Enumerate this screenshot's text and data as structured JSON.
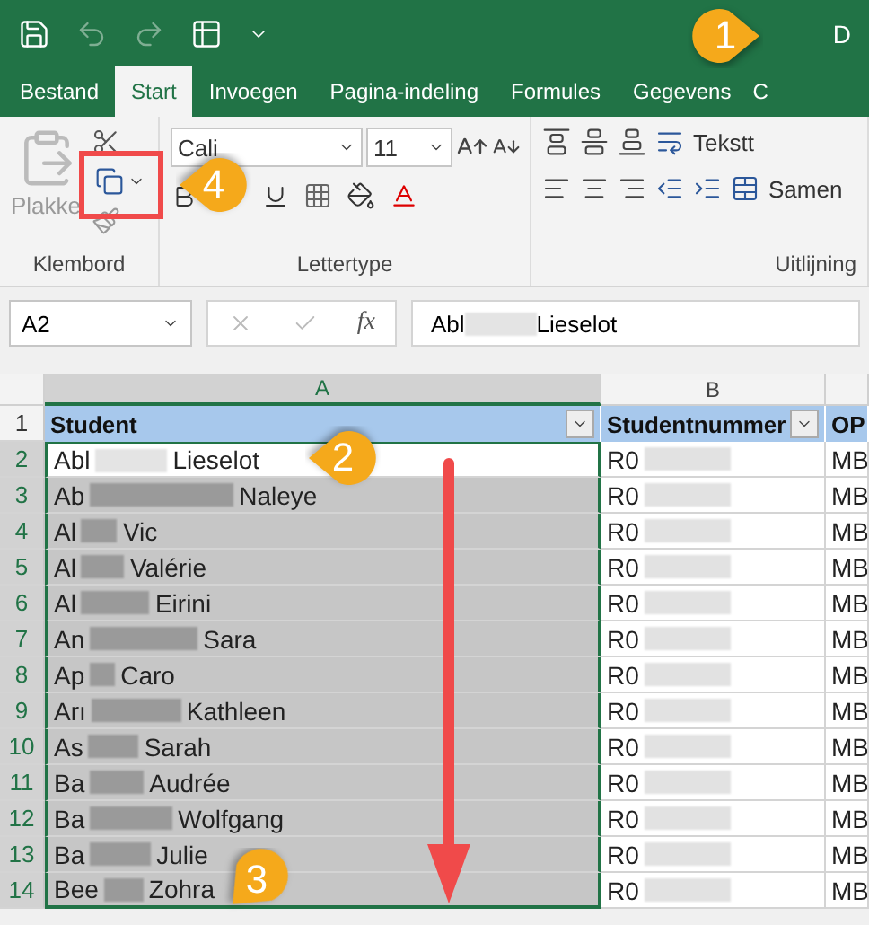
{
  "title_bar": {
    "title": "D"
  },
  "ribbon_tabs": [
    {
      "label": "Bestand",
      "selected": false
    },
    {
      "label": "Start",
      "selected": true
    },
    {
      "label": "Invoegen",
      "selected": false
    },
    {
      "label": "Pagina-indeling",
      "selected": false
    },
    {
      "label": "Formules",
      "selected": false
    },
    {
      "label": "Gegevens",
      "selected": false
    },
    {
      "label": "C",
      "selected": false
    }
  ],
  "ribbon": {
    "paste_label": "Plakke",
    "font_name": "Cali",
    "font_size": "11",
    "wrap_label": "Tekstt",
    "merge_label": "Samen",
    "groups": [
      "Klembord",
      "Lettertype",
      "Uitlijning"
    ]
  },
  "formula_bar": {
    "name_box": "A2",
    "function_label": "fx",
    "value_prefix": "Abl",
    "value_suffix": "Lieselot"
  },
  "sheet": {
    "columns": [
      "A",
      "B"
    ],
    "header_row": {
      "number": "1",
      "cells": [
        "Student",
        "Studentnummer",
        "OP"
      ]
    },
    "rows": [
      {
        "number": "2",
        "prefix": "Abl",
        "suffix": "Lieselot",
        "id_prefix": "R0",
        "code": "MB",
        "selected": true,
        "active": true
      },
      {
        "number": "3",
        "prefix": "Ab",
        "suffix": "Naleye",
        "id_prefix": "R0",
        "code": "MB",
        "selected": true,
        "active": false
      },
      {
        "number": "4",
        "prefix": "Al",
        "suffix": "Vic",
        "id_prefix": "R0",
        "code": "MB",
        "selected": true,
        "active": false
      },
      {
        "number": "5",
        "prefix": "Al",
        "suffix": "Valérie",
        "id_prefix": "R0",
        "code": "MB",
        "selected": true,
        "active": false
      },
      {
        "number": "6",
        "prefix": "Al",
        "suffix": "Eirini",
        "id_prefix": "R0",
        "code": "MB",
        "selected": true,
        "active": false
      },
      {
        "number": "7",
        "prefix": "An",
        "suffix": "Sara",
        "id_prefix": "R0",
        "code": "MB",
        "selected": true,
        "active": false
      },
      {
        "number": "8",
        "prefix": "Ap",
        "suffix": "Caro",
        "id_prefix": "R0",
        "code": "MB",
        "selected": true,
        "active": false
      },
      {
        "number": "9",
        "prefix": "Arı",
        "suffix": "Kathleen",
        "id_prefix": "R0",
        "code": "MB",
        "selected": true,
        "active": false
      },
      {
        "number": "10",
        "prefix": "As",
        "suffix": "Sarah",
        "id_prefix": "R0",
        "code": "MB",
        "selected": true,
        "active": false
      },
      {
        "number": "11",
        "prefix": "Ba",
        "suffix": "Audrée",
        "id_prefix": "R0",
        "code": "MB",
        "selected": true,
        "active": false
      },
      {
        "number": "12",
        "prefix": "Ba",
        "suffix": "Wolfgang",
        "id_prefix": "R0",
        "code": "MB",
        "selected": true,
        "active": false
      },
      {
        "number": "13",
        "prefix": "Ba",
        "suffix": "Julie",
        "id_prefix": "R0",
        "code": "MB",
        "selected": true,
        "active": false
      },
      {
        "number": "14",
        "prefix": "Bee",
        "suffix": "Zohra",
        "id_prefix": "R0",
        "code": "MB",
        "selected": true,
        "active": false
      }
    ]
  },
  "callouts": [
    {
      "label": "1",
      "kind": "right"
    },
    {
      "label": "4",
      "kind": "left"
    },
    {
      "label": "2",
      "kind": "left"
    },
    {
      "label": "3",
      "kind": "downleft"
    }
  ]
}
